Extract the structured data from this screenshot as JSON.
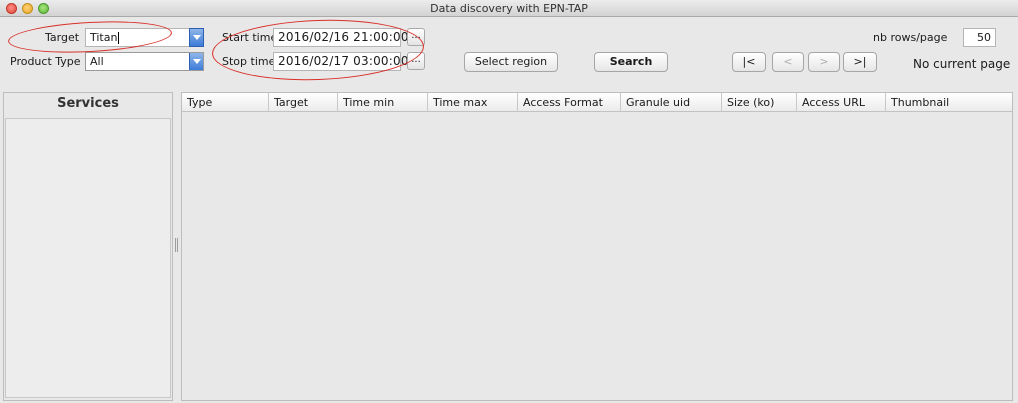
{
  "window": {
    "title": "Data discovery with EPN-TAP"
  },
  "toolbar": {
    "target_label": "Target",
    "target_value": "Titan",
    "product_type_label": "Product Type",
    "product_type_value": "All",
    "start_time_label": "Start time",
    "start_time_value": "2016/02/16 21:00:00",
    "stop_time_label": "Stop time",
    "stop_time_value": "2016/02/17 03:00:00",
    "picker_label": "...",
    "select_region_label": "Select region",
    "search_label": "Search",
    "nav_first": "|<",
    "nav_prev": "<",
    "nav_next": ">",
    "nav_last": ">|",
    "rows_per_page_label": "nb rows/page",
    "rows_per_page_value": "50",
    "page_status": "No current page"
  },
  "services": {
    "title": "Services"
  },
  "results": {
    "columns": [
      "Type",
      "Target",
      "Time min",
      "Time max",
      "Access Format",
      "Granule uid",
      "Size (ko)",
      "Access URL",
      "Thumbnail"
    ]
  },
  "colors": {
    "annotation": "#d9302a",
    "combo_arrow": "#3d7bd9"
  },
  "icons": [
    "close-icon",
    "minimize-icon",
    "zoom-icon",
    "chevron-down-icon"
  ]
}
